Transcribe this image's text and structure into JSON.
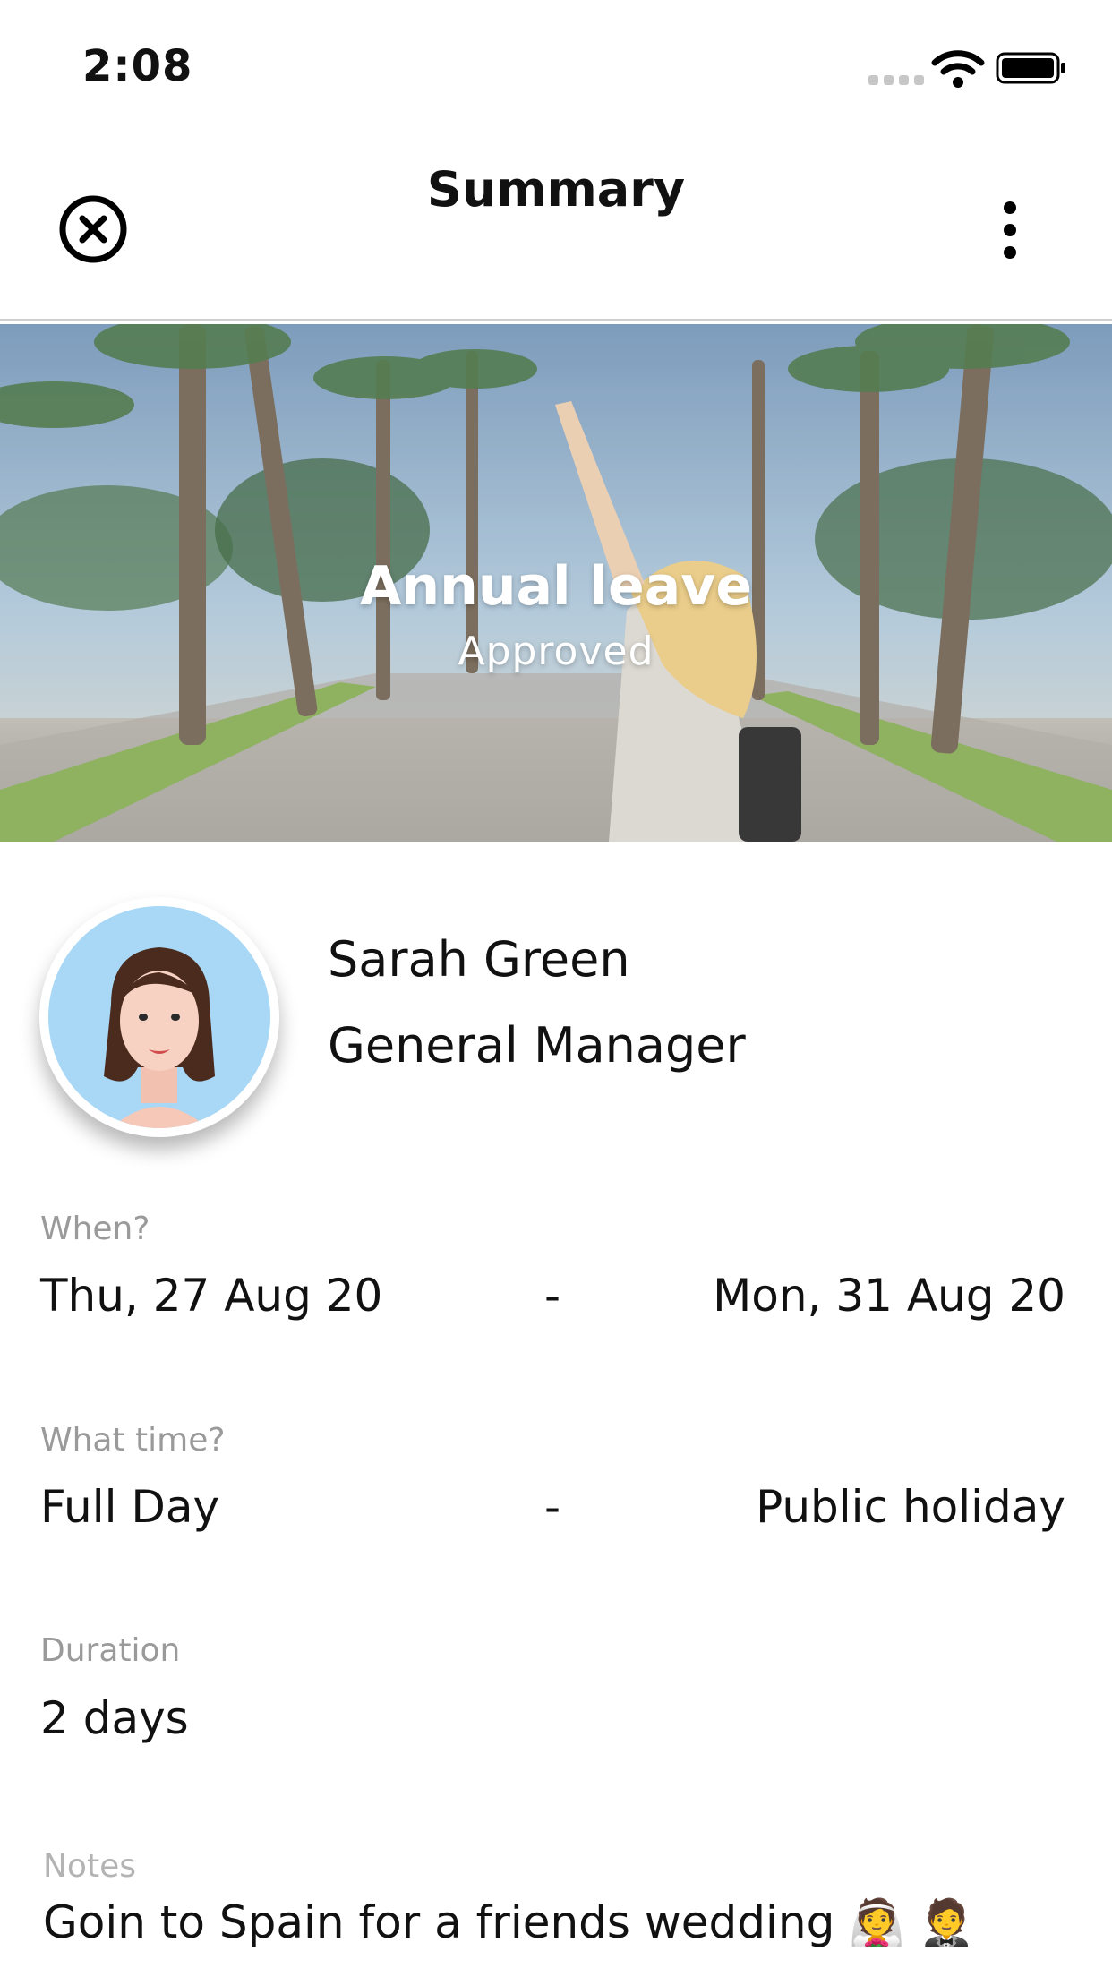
{
  "status_bar": {
    "time": "2:08"
  },
  "nav": {
    "title": "Summary",
    "close_icon": "close-circle-icon",
    "more_icon": "more-vertical-icon"
  },
  "hero": {
    "title": "Annual leave",
    "status": "Approved"
  },
  "profile": {
    "name": "Sarah Green",
    "role": "General Manager"
  },
  "details": {
    "when": {
      "label": "When?",
      "start": "Thu, 27 Aug 20",
      "separator": "-",
      "end": "Mon, 31 Aug 20"
    },
    "time": {
      "label": "What time?",
      "start": "Full Day",
      "separator": "-",
      "end": "Public holiday"
    },
    "duration": {
      "label": "Duration",
      "value": "2 days"
    },
    "notes": {
      "label": "Notes",
      "value": "Goin to Spain for a friends wedding 👰 🤵"
    }
  },
  "colors": {
    "accent": "#111111",
    "avatar_bg": "#a8d8f5",
    "label": "#9a9a9a"
  }
}
